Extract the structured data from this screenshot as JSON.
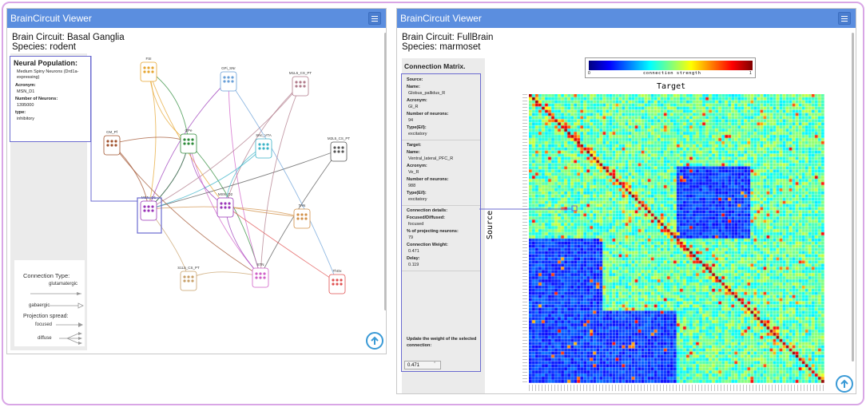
{
  "left_window": {
    "title": "BrainCircuit Viewer",
    "circuit_label": "Brain Circuit: Basal Ganglia",
    "species_label": "Species: rodent",
    "neural_population": {
      "header": "Neural Population:",
      "name": "Medium Spiny Neurons (Drd1a-expressing)",
      "acronym_label": "Acronym:",
      "acronym": "MSN_D1",
      "neurons_label": "Number of Neurons:",
      "neurons": "1395000",
      "type_label": "type:",
      "type": "inhibitory"
    },
    "legend": {
      "connection_type": "Connection Type:",
      "glutamatergic": "glutamatergic",
      "gabaergic": "gabaergic",
      "projection_spread": "Projection spread:",
      "focused": "focused",
      "diffuse": "diffuse"
    },
    "nodes": [
      {
        "label": "FSI",
        "color": "#e6a530"
      },
      {
        "label": "GPi_SNr",
        "color": "#6aa0d8"
      },
      {
        "label": "M1L5_CS_PT",
        "color": "#b07a8a"
      },
      {
        "label": "CM_Pf",
        "color": "#a0522d"
      },
      {
        "label": "GPe",
        "color": "#2e8b3a"
      },
      {
        "label": "SNc_VTA",
        "color": "#3cb4c8"
      },
      {
        "label": "M2L5_CS_PT",
        "color": "#555555"
      },
      {
        "label": "MSN_D1",
        "color": "#9a35b8"
      },
      {
        "label": "MSN_D2",
        "color": "#9a35b8"
      },
      {
        "label": "TAN",
        "color": "#d2914a"
      },
      {
        "label": "S1L5_CS_PT",
        "color": "#c8a06a"
      },
      {
        "label": "STN",
        "color": "#d060c8"
      },
      {
        "label": "ThOx",
        "color": "#e05050"
      }
    ]
  },
  "right_window": {
    "title": "BrainCircuit Viewer",
    "circuit_label": "Brain Circuit: FullBrain",
    "species_label": "Species: marmoset",
    "matrix_header": "Connection Matrix.",
    "colorbar": {
      "min": "0",
      "max": "1",
      "label": "connection strength"
    },
    "target_label": "Target",
    "source_label": "Source",
    "source": {
      "header": "Source:",
      "name_label": "Name:",
      "name": "Globus_pallidus_R",
      "acronym_label": "Acronym:",
      "acronym": "Gl_R",
      "neurons_label": "Number of neurons:",
      "neurons": "94",
      "type_label": "Type(E/I):",
      "type": "excitatory"
    },
    "target": {
      "header": "Target:",
      "name_label": "Name:",
      "name": "Ventral_lateral_PFC_R",
      "acronym_label": "Acronym:",
      "acronym": "Ve_R",
      "neurons_label": "Number of neurons:",
      "neurons": "988",
      "type_label": "Type(E/I):",
      "type": "excitatory"
    },
    "details": {
      "header": "Connection details:",
      "focused_label": "Focused/Diffused:",
      "focused": "focused",
      "percent_label": "% of projecting neurons:",
      "percent": "79",
      "weight_label": "Connection Weight:",
      "weight": "0.471",
      "delay_label": "Delay:",
      "delay": "0.119"
    },
    "update_label": "Update the weight of the selected connection:",
    "update_value": "0.471"
  }
}
